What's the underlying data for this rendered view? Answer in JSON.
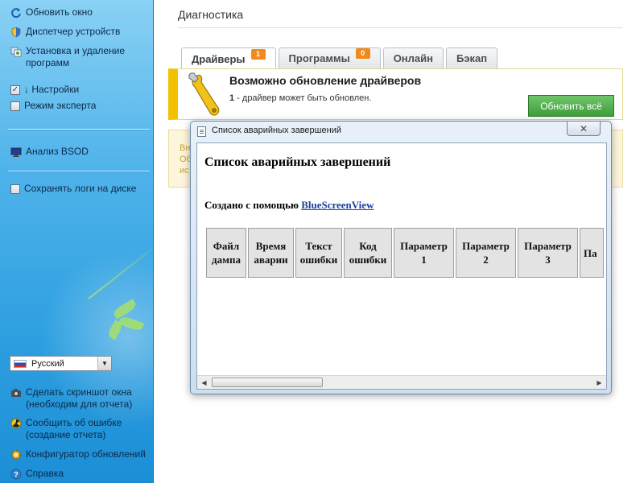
{
  "sidebar": {
    "items": [
      {
        "label": "Обновить окно",
        "icon": "refresh-icon"
      },
      {
        "label": "Диспетчер устройств",
        "icon": "shield-icon"
      },
      {
        "label": "Установка и удаление программ",
        "icon": "programs-icon"
      },
      {
        "label": "↓ Настройки",
        "checked": true
      },
      {
        "label": "Режим эксперта",
        "checked": false
      },
      {
        "label": "Анализ BSOD",
        "icon": "monitor-icon"
      },
      {
        "label": "Сохранять логи на диске",
        "checked": false
      }
    ],
    "language": "Русский",
    "bottom_items": [
      {
        "label": "Сделать скриншот окна (необходим для отчета)",
        "icon": "camera-icon"
      },
      {
        "label": "Сообщить об ошибке (создание отчета)",
        "icon": "radiation-icon"
      },
      {
        "label": "Конфигуратор обновлений",
        "icon": "gear-icon"
      },
      {
        "label": "Справка",
        "icon": "help-icon"
      }
    ]
  },
  "main": {
    "title": "Диагностика",
    "tabs": [
      {
        "label": "Драйверы",
        "badge": "1",
        "active": true
      },
      {
        "label": "Программы",
        "badge": "0",
        "active": false
      },
      {
        "label": "Онлайн",
        "active": false
      },
      {
        "label": "Бэкап",
        "active": false
      }
    ],
    "update_panel": {
      "title": "Возможно обновление драйверов",
      "count": "1",
      "subtitle": " - драйвер может быть обновлен.",
      "button": "Обновить всё"
    },
    "background_panel": {
      "line1": "Вн",
      "line2": "Об",
      "line3": "ис"
    }
  },
  "popup": {
    "title": "Список аварийных завершений",
    "heading": "Список аварийных завершений",
    "created_prefix": "Создано с помощью ",
    "created_link": "BlueScreenView",
    "columns": [
      "Файл дампа",
      "Время аварии",
      "Текст ошибки",
      "Код ошибки",
      "Параметр 1",
      "Параметр 2",
      "Параметр 3",
      "Па"
    ]
  },
  "colors": {
    "sidebar_top": "#8ad1f5",
    "sidebar_bottom": "#1c8ed6",
    "accent_orange": "#f08a1c",
    "update_green": "#3f9e3a",
    "warning_yellow": "#f2c200",
    "link_blue": "#1a3f9e"
  }
}
